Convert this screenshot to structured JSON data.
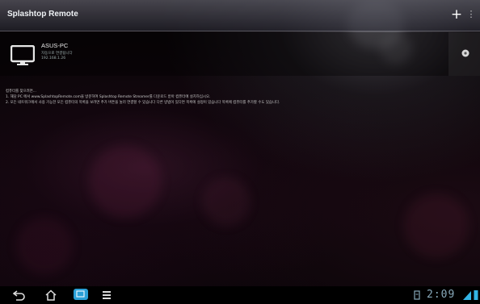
{
  "app": {
    "title": "Splashtop Remote"
  },
  "actions": {
    "add_label": "+",
    "menu_label": "⋮"
  },
  "computers": [
    {
      "name": "ASUS-PC",
      "status": "자동으로 연결됩니다",
      "ip": "192.168.1.26"
    }
  ],
  "info": {
    "line1": "컴퓨터를 찾으려면...",
    "line2": "1. 해당 PC 에서 www.SplashtopRemote.com을 방문하여 Splashtop Remote Streamer를 다운로드 받아 컴퓨터에 설치하십시오.",
    "line3": "2. 모든 네트워크에서 사용 가능한 모든 컴퓨터의 목록을 보려면 추가 버튼을 눌러 연결할 수 있습니다 다른 방법이 있다면 목록에 설정이 있습니다 목록에 컴퓨터를 추가할 수도 있습니다."
  },
  "status_bar": {
    "time": "2:09"
  },
  "colors": {
    "accent": "#33b5e5",
    "background": "#0a0508"
  },
  "icons": [
    "back-icon",
    "home-icon",
    "recent-apps-icon",
    "menu-icon",
    "monitor-icon",
    "settings-icon",
    "wifi-icon",
    "battery-icon"
  ]
}
